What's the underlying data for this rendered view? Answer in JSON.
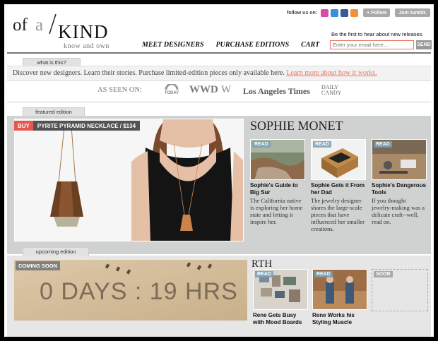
{
  "header": {
    "logo": {
      "of": "of",
      "a": "a",
      "kind": "KIND",
      "tagline": "know and own"
    },
    "follow_label": "follow us on:",
    "follow_button": "+ Follow",
    "tumblr_button": "Join tumblr.",
    "nav": [
      "MEET DESIGNERS",
      "PURCHASE EDITIONS",
      "CART"
    ],
    "email_promo": "Be the first to hear about new releases.",
    "email_placeholder": "Enter your email here...",
    "send_label": "SEND"
  },
  "what_is_this": {
    "tab": "what is this?",
    "text": "Discover new designers. Learn their stories. Purchase limited-edition pieces only available here.",
    "link": "Learn more about how it works."
  },
  "as_seen_on": {
    "label": "AS SEEN ON:",
    "outlets": [
      "TODAY",
      "WWD",
      "W",
      "Los Angeles Times",
      "DAILY CANDY"
    ]
  },
  "featured": {
    "tab": "featured edition",
    "buy_label": "BUY",
    "product": "PYRITE PYRAMID NECKLACE / $134",
    "designer": "SOPHIE MONET",
    "read_label": "READ",
    "stories": [
      {
        "title": "Sophie's Guide to Big Sur",
        "desc": "The California native is exploring her home state and letting it inspire her."
      },
      {
        "title": "Sophie Gets it From her Dad",
        "desc": "The jewelry designer shares the large-scale pieces that have influenced her smaller creations."
      },
      {
        "title": "Sophie's Dangerous Tools",
        "desc": "If you thought jewelry-making was a delicate craft--well, read on."
      }
    ]
  },
  "upcoming": {
    "tab": "upcoming edition",
    "coming_soon": "COMING SOON",
    "countdown": "0 DAYS : 19 HRS",
    "designer": "RTH",
    "soon_label": "SOON",
    "stories": [
      {
        "title": "Rene Gets Busy with Mood Boards"
      },
      {
        "title": "Rene Works his Styling Muscle"
      }
    ]
  },
  "colors": {
    "accent": "#e8765f",
    "buy": "#e8574f",
    "panel": "#d0d2d2"
  }
}
